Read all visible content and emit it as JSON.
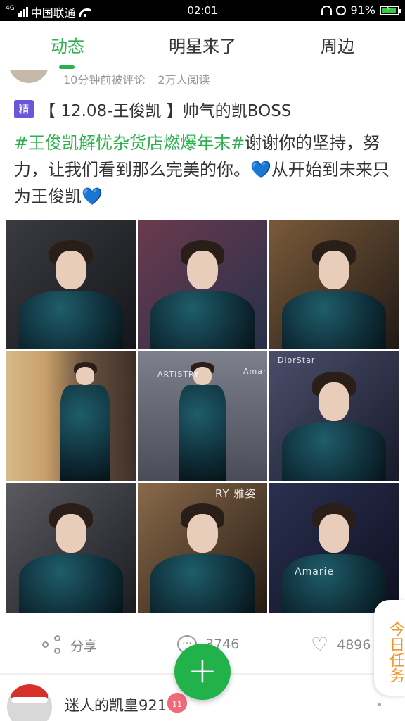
{
  "status_bar": {
    "signal_label": "4G",
    "carrier": "中国联通",
    "time": "02:01",
    "battery": "91%",
    "battery_level": 0.91
  },
  "tabs": [
    {
      "label": "动态",
      "active": true
    },
    {
      "label": "明星来了",
      "active": false
    },
    {
      "label": "周边",
      "active": false
    }
  ],
  "post": {
    "meta_time": "10分钟前被评论",
    "meta_reads": "2万人阅读",
    "badge": "精",
    "title": "【 12.08-王俊凯 】帅气的凯BOSS",
    "hashtag": "#王俊凯解忧杂货店燃爆年末#",
    "body_part1": "谢谢你的坚持，努力，让我们看到那么完美的你。",
    "body_part2": "从开始到未来只为王俊凯",
    "heart_emoji": "💙",
    "photos": [
      {
        "name": "photo-1"
      },
      {
        "name": "photo-2"
      },
      {
        "name": "photo-3"
      },
      {
        "name": "photo-4"
      },
      {
        "name": "photo-5",
        "watermark_top": "ARTISTRY",
        "watermark_right": "Amarie"
      },
      {
        "name": "photo-6",
        "watermark_top": "DiorStar"
      },
      {
        "name": "photo-7"
      },
      {
        "name": "photo-8",
        "watermark_top": "RY 雅姿"
      },
      {
        "name": "photo-9",
        "watermark_top": "Amarie"
      }
    ],
    "share_label": "分享",
    "comment_count": "3746",
    "like_count": "4896"
  },
  "fab": {
    "icon": "plus-icon",
    "color": "#22b24c"
  },
  "daily_task": {
    "label": "今日任务"
  },
  "next_post": {
    "author": "迷人的凯皇921",
    "level": "11"
  },
  "colors": {
    "accent": "#2bb24c",
    "badge": "#6b55d8",
    "task": "#f29326"
  }
}
